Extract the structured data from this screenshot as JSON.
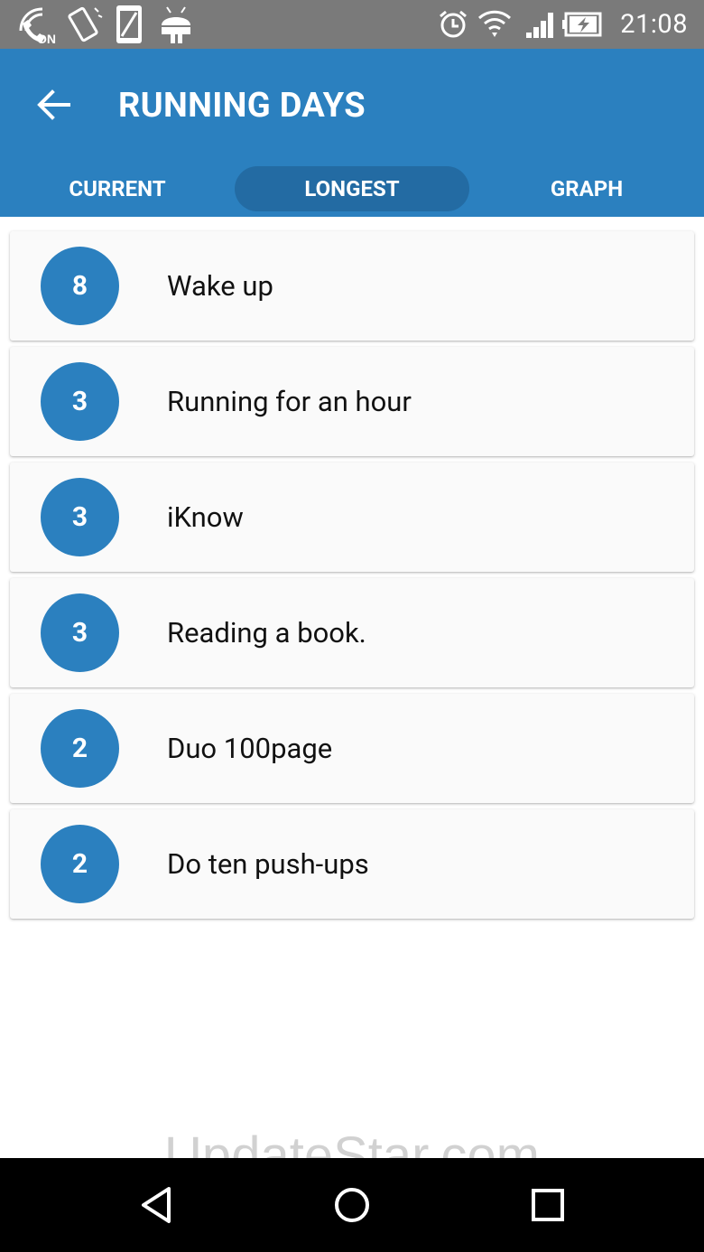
{
  "status_bar": {
    "time": "21:08",
    "left_icons": [
      "volte-on-icon",
      "screen-rotation-icon",
      "phone-icon",
      "android-icon"
    ],
    "right_icons": [
      "alarm-icon",
      "wifi-icon",
      "signal-icon",
      "battery-charging-icon"
    ]
  },
  "app_bar": {
    "title": "RUNNING DAYS",
    "back_icon": "arrow-left-icon",
    "color": "#2b80bf"
  },
  "tabs": [
    {
      "label": "CURRENT",
      "active": false
    },
    {
      "label": "LONGEST",
      "active": true
    },
    {
      "label": "GRAPH",
      "active": false
    }
  ],
  "habits": [
    {
      "days": "8",
      "name": "Wake up"
    },
    {
      "days": "3",
      "name": "Running for an hour"
    },
    {
      "days": "3",
      "name": "iKnow"
    },
    {
      "days": "3",
      "name": "Reading a book."
    },
    {
      "days": "2",
      "name": "Duo 100page"
    },
    {
      "days": "2",
      "name": "Do ten push-ups"
    }
  ],
  "watermark": "UpdateStar.com",
  "nav_bar": {
    "icons": [
      "back-triangle-icon",
      "home-circle-icon",
      "recents-square-icon"
    ]
  }
}
